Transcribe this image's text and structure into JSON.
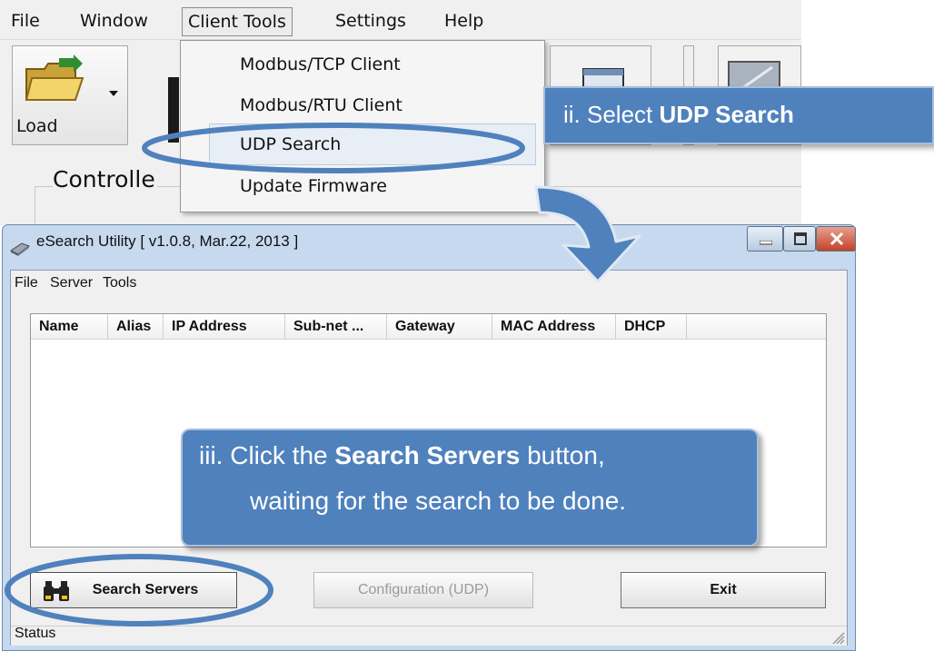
{
  "background_app": {
    "menus": [
      "File",
      "Window",
      "Client Tools",
      "Settings",
      "Help"
    ],
    "toolbar": {
      "load_label": "Load"
    },
    "controller_label": "Controlle",
    "client_tools_menu": {
      "items": [
        "Modbus/TCP Client",
        "Modbus/RTU Client",
        "UDP Search",
        "Update Firmware"
      ],
      "highlighted": "UDP Search"
    }
  },
  "callouts": {
    "step_ii": {
      "prefix": "ii. Select ",
      "bold": "UDP Search"
    },
    "step_iii": {
      "line1_prefix": "iii. Click the ",
      "line1_bold": "Search Servers",
      "line1_suffix": " button,",
      "line2": "waiting for the search to be done."
    },
    "accent_color": "#4f81bd"
  },
  "esearch": {
    "title": "eSearch Utility [ v1.0.8, Mar.22, 2013 ]",
    "menus": [
      "File",
      "Server",
      "Tools"
    ],
    "columns": [
      "Name",
      "Alias",
      "IP Address",
      "Sub-net ...",
      "Gateway",
      "MAC Address",
      "DHCP"
    ],
    "rows": [],
    "buttons": {
      "search_servers": "Search Servers",
      "configuration": "Configuration (UDP)",
      "exit": "Exit"
    },
    "status": "Status",
    "icons": {
      "app": "network-device-icon",
      "search": "binoculars-icon",
      "minimize": "minimize-icon",
      "maximize": "maximize-icon",
      "close": "close-icon"
    }
  },
  "annotations": {
    "ellipse_color": "#4f81bd",
    "arrow_color": "#4f81bd"
  }
}
